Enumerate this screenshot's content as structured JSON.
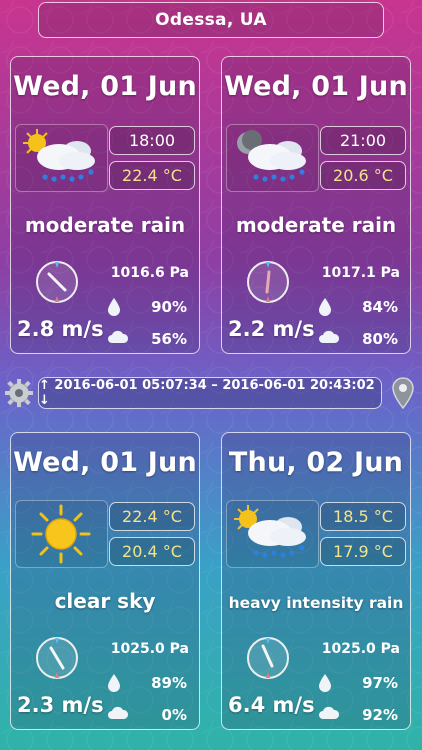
{
  "header": {
    "city": "Odessa, UA"
  },
  "timebar": {
    "range": "↑ 2016-06-01 05:07:34 – 2016-06-01 20:43:02 ↓"
  },
  "icons": {
    "settings": "gear-icon",
    "location": "map-pin-icon"
  },
  "colors": {
    "temperature": "#f3e48a",
    "rain": "#2f7fe0"
  },
  "cards": [
    {
      "date": "Wed, 01 Jun",
      "icon": "sun-cloud-rain-icon",
      "top_value": "18:00",
      "bottom_value": "22.4 °C",
      "condition": "moderate rain",
      "wind": "2.8 m/s",
      "pressure": "1016.6 Pa",
      "humidity": "90%",
      "clouds": "56%"
    },
    {
      "date": "Wed, 01 Jun",
      "icon": "moon-cloud-rain-icon",
      "top_value": "21:00",
      "bottom_value": "20.6 °C",
      "condition": "moderate rain",
      "wind": "2.2 m/s",
      "pressure": "1017.1 Pa",
      "humidity": "84%",
      "clouds": "80%"
    },
    {
      "date": "Wed, 01 Jun",
      "icon": "sun-icon",
      "top_value": "22.4 °C",
      "bottom_value": "20.4 °C",
      "condition": "clear sky",
      "wind": "2.3 m/s",
      "pressure": "1025.0 Pa",
      "humidity": "89%",
      "clouds": "0%"
    },
    {
      "date": "Thu, 02 Jun",
      "icon": "sun-cloud-rain-icon",
      "top_value": "18.5 °C",
      "bottom_value": "17.9 °C",
      "condition": "heavy intensity rain",
      "wind": "6.4 m/s",
      "pressure": "1025.0 Pa",
      "humidity": "97%",
      "clouds": "92%"
    }
  ]
}
